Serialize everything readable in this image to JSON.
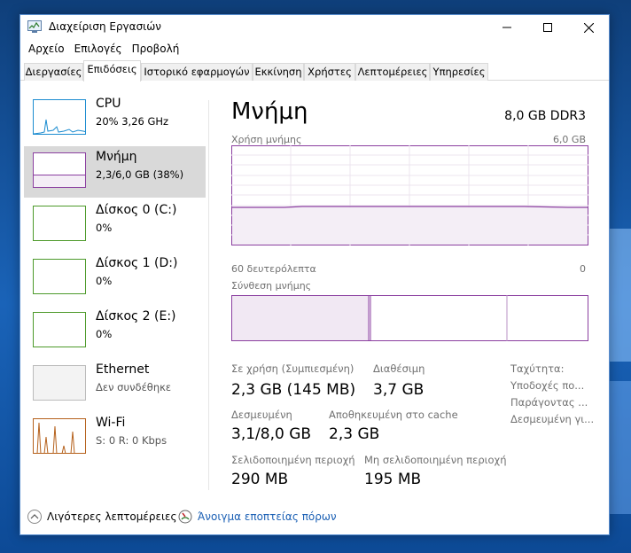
{
  "window": {
    "title": "Διαχείριση Εργασιών"
  },
  "menu": [
    "Αρχείο",
    "Επιλογές",
    "Προβολή"
  ],
  "tabs": [
    {
      "label": "Διεργασίες",
      "active": false
    },
    {
      "label": "Επιδόσεις",
      "active": true
    },
    {
      "label": "Ιστορικό εφαρμογών",
      "active": false
    },
    {
      "label": "Εκκίνηση",
      "active": false
    },
    {
      "label": "Χρήστες",
      "active": false
    },
    {
      "label": "Λεπτομέρειες",
      "active": false
    },
    {
      "label": "Υπηρεσίες",
      "active": false
    }
  ],
  "sidebar": {
    "items": [
      {
        "title": "CPU",
        "subtitle": "20%  3,26 GHz",
        "color": "#1c8cd0",
        "selected": false
      },
      {
        "title": "Μνήμη",
        "subtitle": "2,3/6,0 GB (38%)",
        "color": "#8b3fa0",
        "selected": true
      },
      {
        "title": "Δίσκος 0 (C:)",
        "subtitle": "0%",
        "color": "#4d9a2a",
        "selected": false
      },
      {
        "title": "Δίσκος 1 (D:)",
        "subtitle": "0%",
        "color": "#4d9a2a",
        "selected": false
      },
      {
        "title": "Δίσκος 2 (E:)",
        "subtitle": "0%",
        "color": "#4d9a2a",
        "selected": false
      },
      {
        "title": "Ethernet",
        "subtitle": "Δεν συνδέθηκε",
        "color": "#bbbbbb",
        "selected": false
      },
      {
        "title": "Wi-Fi",
        "subtitle": "S: 0 R: 0 Kbps",
        "color": "#b5611c",
        "selected": false
      }
    ]
  },
  "main": {
    "title": "Μνήμη",
    "spec": "8,0 GB DDR3",
    "usage_label": "Χρήση μνήμης",
    "usage_max": "6,0 GB",
    "time_left": "60 δευτερόλεπτα",
    "time_right": "0",
    "composition_label": "Σύνθεση μνήμης",
    "usage_fraction": 0.38
  },
  "stats": {
    "in_use_label": "Σε χρήση (Συμπιεσμένη)",
    "in_use_value": "2,3 GB (145 MB)",
    "available_label": "Διαθέσιμη",
    "available_value": "3,7 GB",
    "committed_label": "Δεσμευμένη",
    "committed_value": "3,1/8,0 GB",
    "cached_label": "Αποθηκευμένη στο cache",
    "cached_value": "2,3 GB",
    "paged_label": "Σελιδοποιημένη περιοχή",
    "paged_value": "290 MB",
    "nonpaged_label": "Μη σελιδοποιημένη περιοχή",
    "nonpaged_value": "195 MB",
    "speed_label": "Ταχύτητα:",
    "slots_label": "Υποδοχές πο...",
    "form_label": "Παράγοντας ...",
    "reserved_label": "Δεσμευμένη γι..."
  },
  "footer": {
    "fewer_details": "Λιγότερες λεπτομέρειες",
    "open_monitor": "Άνοιγμα εποπτείας πόρων"
  },
  "colors": {
    "memory": "#8b3fa0",
    "memory_fill": "#f4eef6",
    "accent_link": "#1a5fb4"
  }
}
